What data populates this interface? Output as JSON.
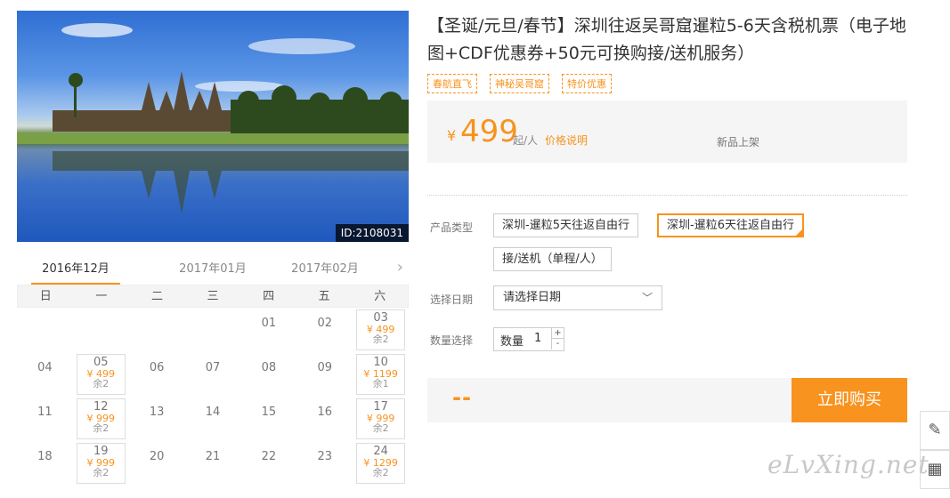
{
  "hero": {
    "id_label": "ID:2108031"
  },
  "months": {
    "tabs": [
      "2016年12月",
      "2017年01月",
      "2017年02月"
    ],
    "next_icon": "›"
  },
  "calendar": {
    "weekdays": [
      "日",
      "一",
      "二",
      "三",
      "四",
      "五",
      "六"
    ],
    "rows": [
      [
        {
          "d": ""
        },
        {
          "d": ""
        },
        {
          "d": ""
        },
        {
          "d": ""
        },
        {
          "d": "01"
        },
        {
          "d": "02"
        },
        {
          "d": "03",
          "p": "¥ 499",
          "s": "余2"
        }
      ],
      [
        {
          "d": "04"
        },
        {
          "d": "05",
          "p": "¥ 499",
          "s": "余2"
        },
        {
          "d": "06"
        },
        {
          "d": "07"
        },
        {
          "d": "08"
        },
        {
          "d": "09"
        },
        {
          "d": "10",
          "p": "¥ 1199",
          "s": "余1"
        }
      ],
      [
        {
          "d": "11"
        },
        {
          "d": "12",
          "p": "¥ 999",
          "s": "余2"
        },
        {
          "d": "13"
        },
        {
          "d": "14"
        },
        {
          "d": "15"
        },
        {
          "d": "16"
        },
        {
          "d": "17",
          "p": "¥ 999",
          "s": "余2"
        }
      ],
      [
        {
          "d": "18"
        },
        {
          "d": "19",
          "p": "¥ 999",
          "s": "余2"
        },
        {
          "d": "20"
        },
        {
          "d": "21"
        },
        {
          "d": "22"
        },
        {
          "d": "23"
        },
        {
          "d": "24",
          "p": "¥ 1299",
          "s": "余2"
        }
      ]
    ]
  },
  "product": {
    "title": "【圣诞/元旦/春节】深圳往返吴哥窟暹粒5-6天含税机票（电子地图+CDF优惠券+50元可换购接/送机服务）",
    "tags": [
      "春航直飞",
      "神秘吴哥窟",
      "特价优惠"
    ],
    "price_currency": "¥",
    "price": "499",
    "price_unit": "起/人",
    "price_explain": "价格说明",
    "new_label": "新品上架"
  },
  "form": {
    "type_label": "产品类型",
    "types": [
      "深圳-暹粒5天往返自由行",
      "深圳-暹粒6天往返自由行",
      "接/送机（单程/人）"
    ],
    "selected_type": 1,
    "date_label": "选择日期",
    "date_placeholder": "请选择日期",
    "qty_label": "数量选择",
    "qty_inner_label": "数量",
    "qty_value": "1",
    "qty_plus": "+",
    "qty_minus": "-"
  },
  "buy": {
    "total": "--",
    "button": "立即购买"
  },
  "side": {
    "edit_icon": "✎",
    "qr_icon": "▦"
  },
  "watermark": "eLvXing.net",
  "colors": {
    "accent": "#f7931e"
  }
}
